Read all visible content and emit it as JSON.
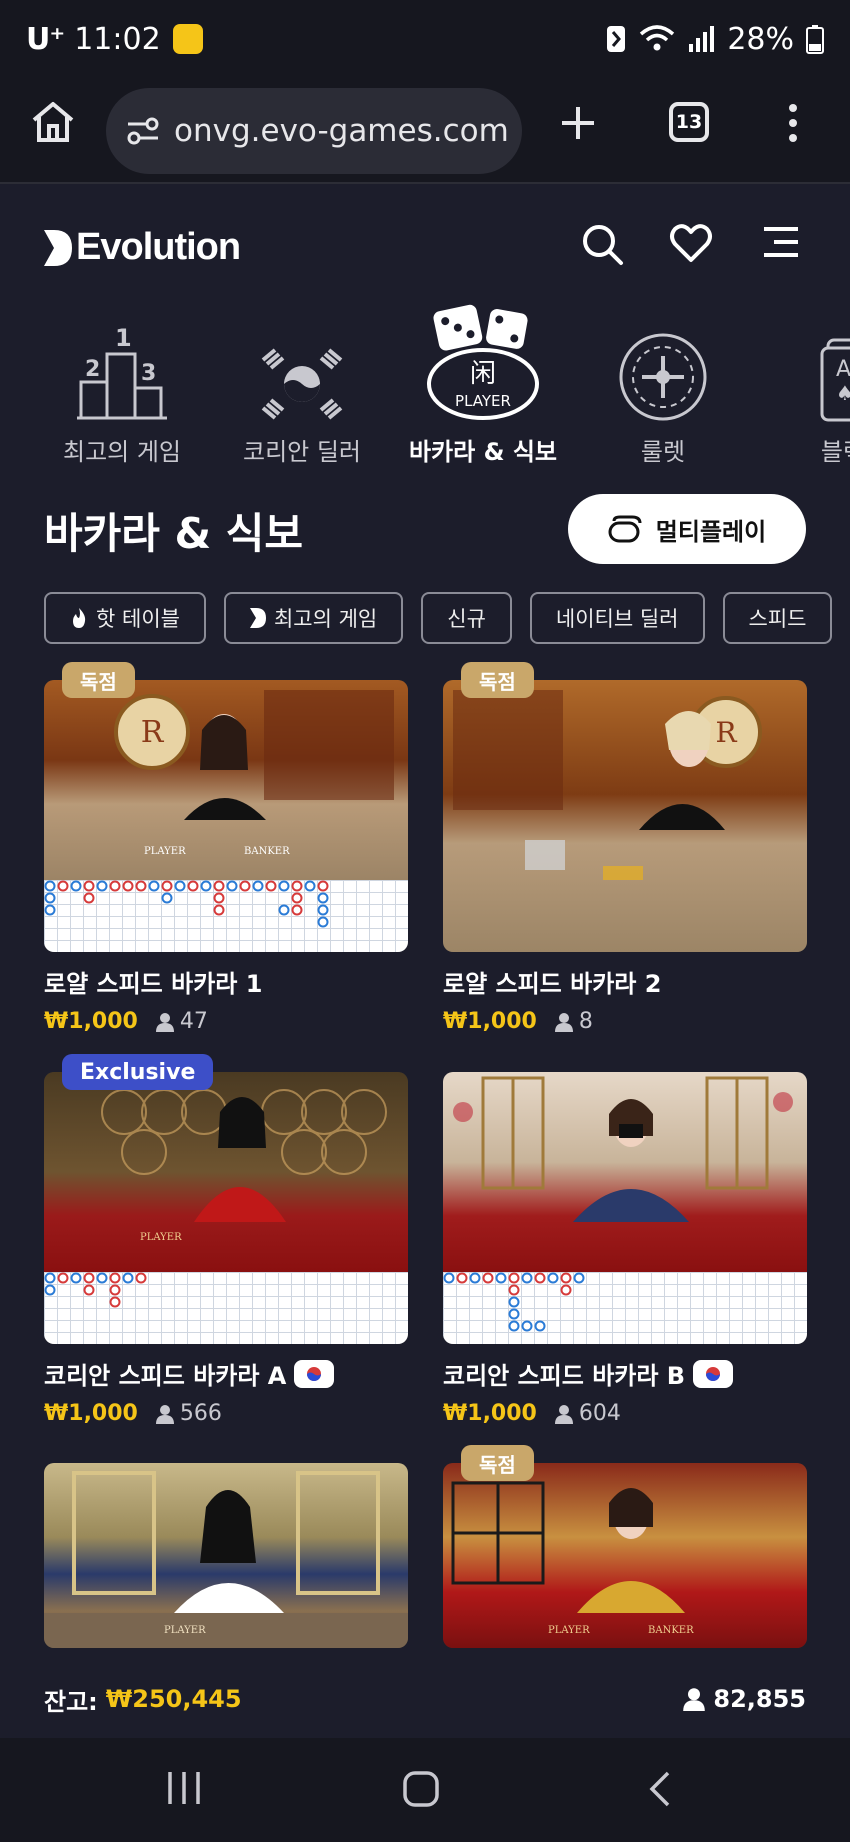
{
  "status_bar": {
    "carrier": "U⁺",
    "time": "11:02",
    "battery": "28%"
  },
  "browser": {
    "url": "onvg.evo-games.com",
    "tab_count": "13"
  },
  "site": {
    "brand": "Evolution"
  },
  "categories": [
    {
      "label": "최고의 게임"
    },
    {
      "label": "코리안 딜러"
    },
    {
      "label": "바카라 & 식보"
    },
    {
      "label": "룰렛"
    },
    {
      "label": "블랙"
    }
  ],
  "section": {
    "title": "바카라 & 식보",
    "multiplay_label": "멀티플레이"
  },
  "filters": [
    {
      "label": "핫 테이블",
      "icon": "flame-icon"
    },
    {
      "label": "최고의 게임",
      "icon": "evolution-icon"
    },
    {
      "label": "신규"
    },
    {
      "label": "네이티브 딜러"
    },
    {
      "label": "스피드"
    }
  ],
  "games": [
    {
      "title": "로얄 스피드 바카라 1",
      "price": "₩1,000",
      "players": "47",
      "badge": "독점"
    },
    {
      "title": "로얄 스피드 바카라 2",
      "price": "₩1,000",
      "players": "8",
      "badge": "독점"
    },
    {
      "title": "코리안 스피드 바카라 A",
      "price": "₩1,000",
      "players": "566",
      "badge": "Exclusive"
    },
    {
      "title": "코리안 스피드 바카라 B",
      "price": "₩1,000",
      "players": "604",
      "badge": ""
    },
    {
      "title": "",
      "price": "",
      "players": "",
      "badge": ""
    },
    {
      "title": "",
      "price": "",
      "players": "",
      "badge": "독점"
    }
  ],
  "footer": {
    "balance_label": "잔고:",
    "balance_value": "₩250,445",
    "online_count": "82,855"
  },
  "colors": {
    "background": "#1c1d2b",
    "price": "#f5c518",
    "badge_exclusive_ko": "#c9a76a",
    "badge_exclusive_en": "#3d4fc8"
  }
}
